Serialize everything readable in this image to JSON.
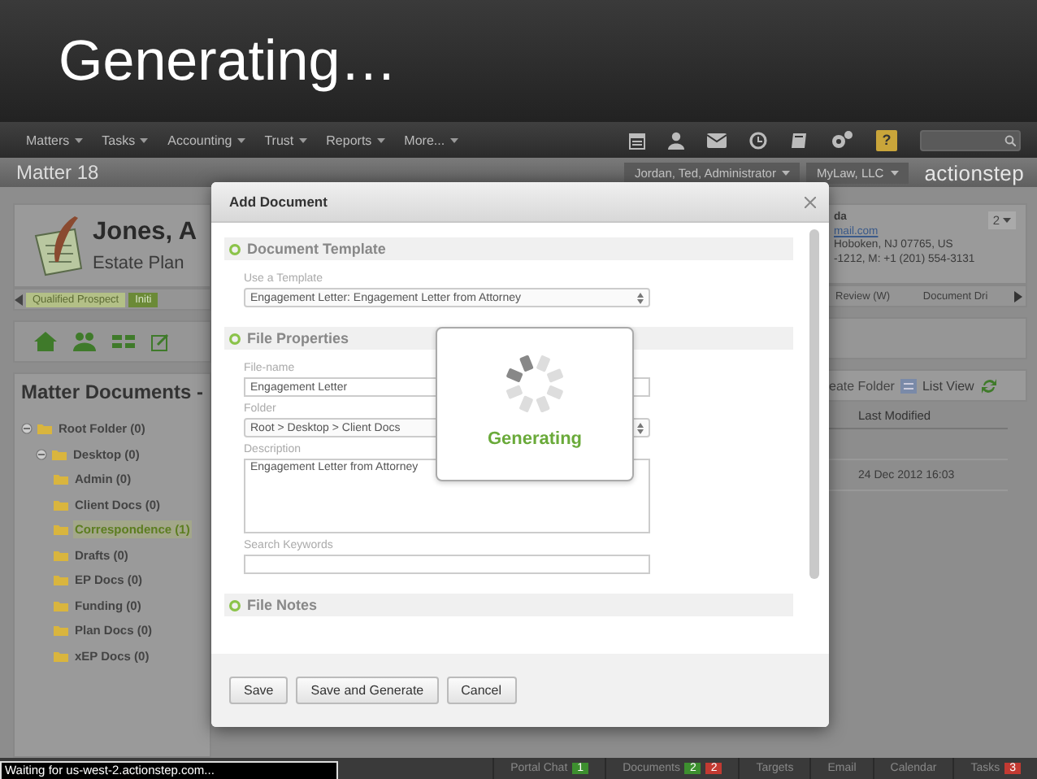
{
  "slide_title": "Generating…",
  "nav": {
    "menus": [
      "Matters",
      "Tasks",
      "Accounting",
      "Trust",
      "Reports",
      "More..."
    ],
    "help": "?"
  },
  "header": {
    "title": "Matter 18",
    "user": "Jordan, Ted, Administrator",
    "firm": "MyLaw, LLC",
    "logo": "actionstep"
  },
  "matter_card": {
    "client": "Jones, A",
    "matter_type": "Estate Plan",
    "contact_lines": [
      "da",
      "mail.com",
      "Hoboken, NJ 07765, US",
      "-1212, M: +1 (201) 554-3131"
    ],
    "count": "2"
  },
  "stages": [
    {
      "label": "Qualified Prospect",
      "completed": true,
      "selected": false
    },
    {
      "label": "Initi",
      "completed": false,
      "selected": true
    },
    {
      "label": "Review (W)",
      "completed": false,
      "selected": false
    },
    {
      "label": "Document Dri",
      "completed": false,
      "selected": false
    }
  ],
  "documents_panel": {
    "title": "Matter Documents -",
    "tree": [
      {
        "label": "Root Folder (0)",
        "expanded": true,
        "selected": false,
        "children": [
          {
            "label": "Desktop (0)",
            "expanded": true,
            "selected": false,
            "children": [
              {
                "label": "Admin (0)",
                "selected": false
              },
              {
                "label": "Client Docs (0)",
                "selected": false
              },
              {
                "label": "Correspondence (1)",
                "selected": true
              },
              {
                "label": "Drafts (0)",
                "selected": false
              },
              {
                "label": "EP Docs (0)",
                "selected": false
              },
              {
                "label": "Funding (0)",
                "selected": false
              },
              {
                "label": "Plan Docs (0)",
                "selected": false
              },
              {
                "label": "xEP Docs (0)",
                "selected": false
              }
            ]
          }
        ]
      }
    ]
  },
  "toolbar": {
    "create_folder": "eate Folder",
    "list_view": "List View"
  },
  "table": {
    "columns": [
      "Last Modified"
    ],
    "rows": [
      [
        "24 Dec 2012 16:03"
      ]
    ]
  },
  "modal": {
    "title": "Add Document",
    "sections": [
      {
        "title": "Document Template",
        "fields": [
          {
            "kind": "select",
            "label": "Use a Template",
            "value": "Engagement Letter: Engagement Letter from Attorney"
          }
        ]
      },
      {
        "title": "File Properties",
        "fields": [
          {
            "kind": "text",
            "label": "File-name",
            "value": "Engagement Letter"
          },
          {
            "kind": "select",
            "label": "Folder",
            "value": "Root > Desktop > Client Docs"
          },
          {
            "kind": "textarea",
            "label": "Description",
            "value": "Engagement Letter from Attorney"
          },
          {
            "kind": "text",
            "label": "Search Keywords"
          }
        ]
      },
      {
        "title": "File Notes"
      }
    ],
    "loader": "Generating",
    "buttons": [
      "Save",
      "Save and Generate",
      "Cancel"
    ]
  },
  "status_bar": {
    "loading": "Waiting for us-west-2.actionstep.com...",
    "tabs": [
      {
        "label": "Portal Chat",
        "badges": [
          {
            "text": "1",
            "color": "#3d8f2f"
          }
        ]
      },
      {
        "label": "Documents",
        "badges": [
          {
            "text": "2",
            "color": "#3d8f2f"
          },
          {
            "text": "2",
            "color": "#c23a32"
          }
        ]
      },
      {
        "label": "Targets"
      },
      {
        "label": "Email"
      },
      {
        "label": "Calendar"
      },
      {
        "label": "Tasks",
        "badges": [
          {
            "text": "3",
            "color": "#c23a32"
          }
        ]
      }
    ]
  }
}
